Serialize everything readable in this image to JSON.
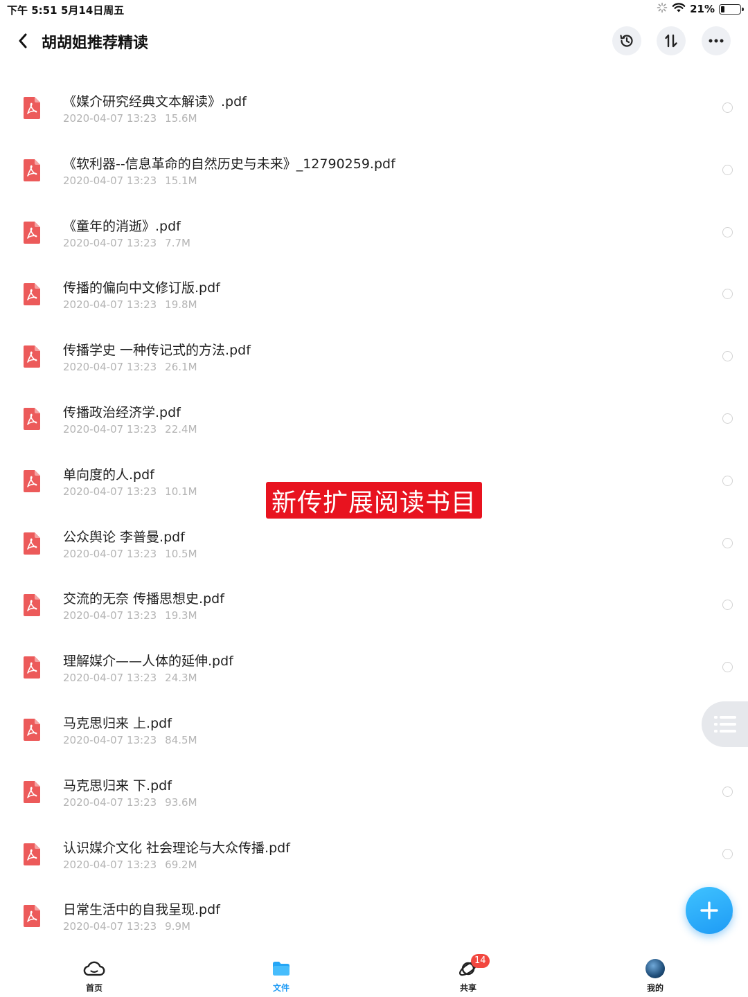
{
  "status_bar": {
    "time": "下午 5:51",
    "date": "5月14日周五",
    "battery": "21%",
    "battery_level": 0.21
  },
  "header": {
    "title": "胡胡姐推荐精读"
  },
  "files": [
    {
      "name": "《媒介研究经典文本解读》.pdf",
      "date": "2020-04-07 13:23",
      "size": "15.6M"
    },
    {
      "name": "《软利器--信息革命的自然历史与未来》_12790259.pdf",
      "date": "2020-04-07 13:23",
      "size": "15.1M"
    },
    {
      "name": "《童年的消逝》.pdf",
      "date": "2020-04-07 13:23",
      "size": "7.7M"
    },
    {
      "name": "传播的偏向中文修订版.pdf",
      "date": "2020-04-07 13:23",
      "size": "19.8M"
    },
    {
      "name": "传播学史  一种传记式的方法.pdf",
      "date": "2020-04-07 13:23",
      "size": "26.1M"
    },
    {
      "name": "传播政治经济学.pdf",
      "date": "2020-04-07 13:23",
      "size": "22.4M"
    },
    {
      "name": "单向度的人.pdf",
      "date": "2020-04-07 13:23",
      "size": "10.1M"
    },
    {
      "name": "公众舆论 李普曼.pdf",
      "date": "2020-04-07 13:23",
      "size": "10.5M"
    },
    {
      "name": "交流的无奈  传播思想史.pdf",
      "date": "2020-04-07 13:23",
      "size": "19.3M"
    },
    {
      "name": "理解媒介——人体的延伸.pdf",
      "date": "2020-04-07 13:23",
      "size": "24.3M"
    },
    {
      "name": "马克思归来  上.pdf",
      "date": "2020-04-07 13:23",
      "size": "84.5M"
    },
    {
      "name": "马克思归来  下.pdf",
      "date": "2020-04-07 13:23",
      "size": "93.6M"
    },
    {
      "name": "认识媒介文化  社会理论与大众传播.pdf",
      "date": "2020-04-07 13:23",
      "size": "69.2M"
    },
    {
      "name": "日常生活中的自我呈现.pdf",
      "date": "2020-04-07 13:23",
      "size": "9.9M"
    }
  ],
  "banner": {
    "text": "新传扩展阅读书目"
  },
  "bottom_nav": {
    "home": "首页",
    "files": "文件",
    "share": "共享",
    "share_badge": "14",
    "me": "我的"
  },
  "colors": {
    "accent": "#1e9bf5",
    "pdf_red": "#ec5a5a",
    "banner_red": "#e8131f",
    "badge_red": "#f2473f"
  },
  "icons": {
    "file": "pdf-file-icon",
    "back": "chevron-left-icon",
    "history": "history-icon",
    "sort": "sort-icon",
    "more": "more-icon"
  }
}
